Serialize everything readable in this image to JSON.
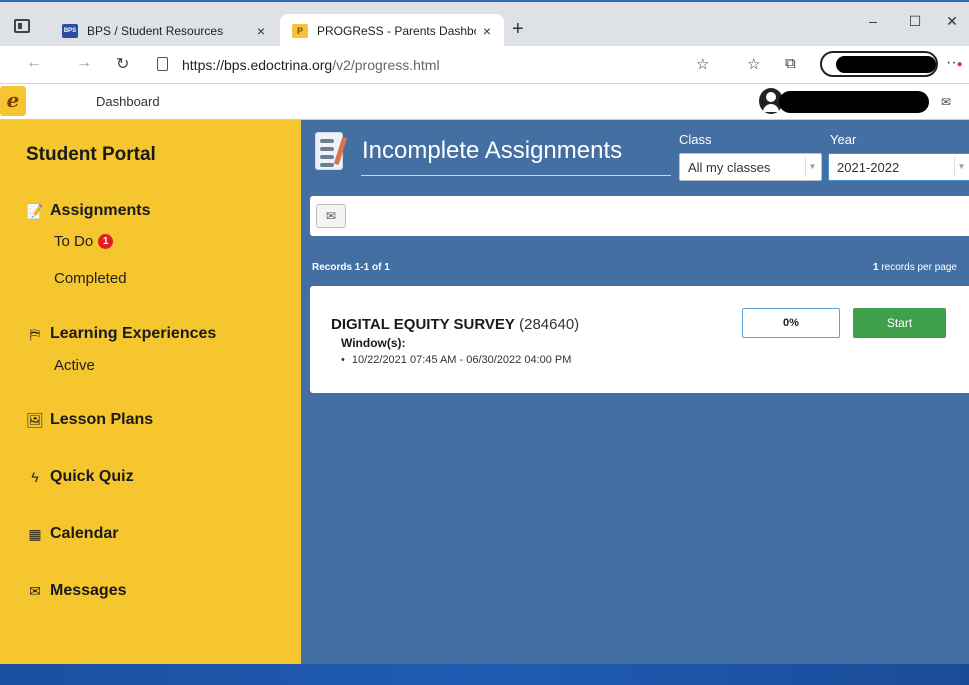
{
  "browser": {
    "tabs": [
      {
        "favicon": "BPS",
        "title": "BPS / Student Resources",
        "close": "×"
      },
      {
        "favicon": "P",
        "title": "PROGReSS - Parents Dashboard",
        "close": "×"
      }
    ],
    "new_tab": "+",
    "window_controls": {
      "minimize": "–",
      "maximize": "☐",
      "close": "✕"
    },
    "url_host": "https://bps.edoctrina.org",
    "url_path": "/v2/progress.html",
    "icons": [
      "tab-actions-icon",
      "back-icon",
      "forward-icon",
      "reload-icon",
      "lock-icon",
      "favorites-add-icon",
      "favorites-icon",
      "collections-icon",
      "profile-icon",
      "more-icon"
    ]
  },
  "app": {
    "nav_dashboard": "Dashboard",
    "logo": "e"
  },
  "sidebar": {
    "title": "Student Portal",
    "sections": {
      "assignments": {
        "label": "Assignments",
        "todo": "To Do",
        "todo_badge": "1",
        "completed": "Completed"
      },
      "learning": {
        "label": "Learning Experiences",
        "active": "Active"
      },
      "lesson_plans": {
        "label": "Lesson Plans"
      },
      "quick_quiz": {
        "label": "Quick Quiz"
      },
      "calendar": {
        "label": "Calendar"
      },
      "messages": {
        "label": "Messages"
      }
    }
  },
  "main": {
    "title": "Incomplete Assignments",
    "filters": {
      "class_label": "Class",
      "class_value": "All my classes",
      "year_label": "Year",
      "year_value": "2021-2022"
    },
    "records_text": "Records 1-1 of 1",
    "per_page_count": "1",
    "per_page_label": "records per page",
    "assignments": [
      {
        "name": "DIGITAL EQUITY SURVEY",
        "id": "(284640)",
        "window_label": "Window(s):",
        "window": "10/22/2021 07:45 AM - 06/30/2022 04:00 PM",
        "progress": "0%",
        "action": "Start"
      }
    ]
  },
  "colors": {
    "sidebar": "#f5c62d",
    "main": "#436fa3",
    "start": "#3f9f4a",
    "badge": "#e02020"
  }
}
